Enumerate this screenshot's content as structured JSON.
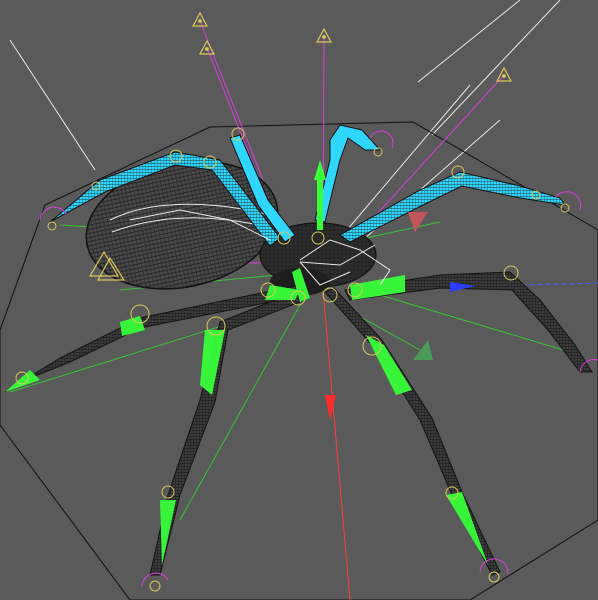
{
  "viewport": {
    "background": "#5a5a5a",
    "wireframe_color": "#1a1a1a",
    "rig_colors": {
      "front_legs": "#39ff39",
      "back_legs": "#2fd7ff",
      "ik_lines": "#d940d9",
      "spine": "#e8e8e8",
      "controller_rings": "#d8c85a",
      "bounding_box": "#111111",
      "axis_x": "#ff2b2b",
      "axis_y": "#2b4bff",
      "axis_z": "#3ac43a"
    }
  },
  "scene": {
    "object": "spider-rig",
    "pole_vector_targets": [
      "triangle-target",
      "triangle-target",
      "triangle-target",
      "triangle-target",
      "triangle-target"
    ],
    "icons": {
      "pole_target": "triangle-target-icon",
      "joint": "joint-circle-icon",
      "foot_roll": "foot-arc-icon",
      "arrow": "direction-arrow-icon"
    }
  }
}
